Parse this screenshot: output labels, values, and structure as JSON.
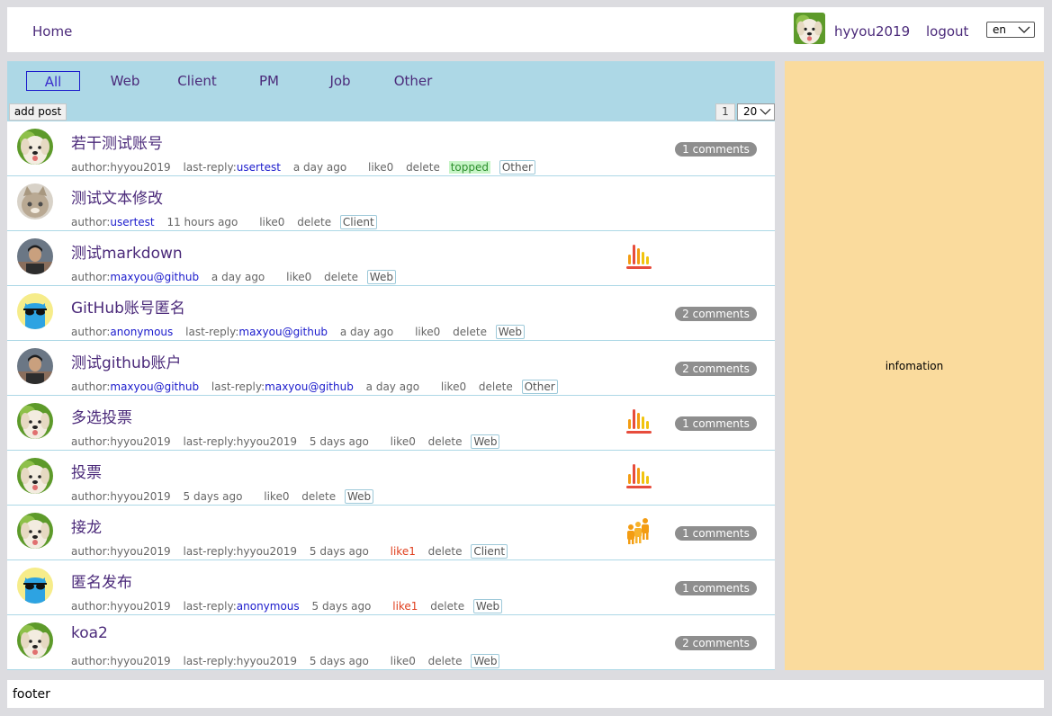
{
  "nav": {
    "home": "Home",
    "username": "hyyou2019",
    "logout": "logout",
    "lang": "en"
  },
  "tabs": [
    "All",
    "Web",
    "Client",
    "PM",
    "Job",
    "Other"
  ],
  "toolbar": {
    "add_post": "add post",
    "page": "1",
    "page_size": "20"
  },
  "info": "infomation",
  "footer": "footer",
  "posts": [
    {
      "title": "若干测试账号",
      "author_label": "author:",
      "author": "hyyou2019",
      "reply_label": "last-reply:",
      "reply": "usertest",
      "time": "a day ago",
      "like": "like0",
      "del": "delete",
      "topped": "topped",
      "tag": "Other",
      "comments": "1 comments"
    },
    {
      "title": "测试文本修改",
      "author_label": "author:",
      "author": "usertest",
      "time": "11 hours ago",
      "like": "like0",
      "del": "delete",
      "tag": "Client"
    },
    {
      "title": "测试markdown",
      "author_label": "author:",
      "author": "maxyou@github",
      "time": "a day ago",
      "like": "like0",
      "del": "delete",
      "tag": "Web"
    },
    {
      "title": "GitHub账号匿名",
      "author_label": "author:",
      "author": "anonymous",
      "reply_label": "last-reply:",
      "reply": "maxyou@github",
      "time": "a day ago",
      "like": "like0",
      "del": "delete",
      "tag": "Web",
      "comments": "2 comments"
    },
    {
      "title": "测试github账户",
      "author_label": "author:",
      "author": "maxyou@github",
      "reply_label": "last-reply:",
      "reply": "maxyou@github",
      "time": "a day ago",
      "like": "like0",
      "del": "delete",
      "tag": "Other",
      "comments": "2 comments"
    },
    {
      "title": "多选投票",
      "author_label": "author:",
      "author": "hyyou2019",
      "reply_label": "last-reply:",
      "reply": "hyyou2019",
      "time": "5 days ago",
      "like": "like0",
      "del": "delete",
      "tag": "Web",
      "comments": "1 comments"
    },
    {
      "title": "投票",
      "author_label": "author:",
      "author": "hyyou2019",
      "time": "5 days ago",
      "like": "like0",
      "del": "delete",
      "tag": "Web"
    },
    {
      "title": "接龙",
      "author_label": "author:",
      "author": "hyyou2019",
      "reply_label": "last-reply:",
      "reply": "hyyou2019",
      "time": "5 days ago",
      "like": "like1",
      "del": "delete",
      "tag": "Client",
      "comments": "1 comments"
    },
    {
      "title": "匿名发布",
      "author_label": "author:",
      "author": "hyyou2019",
      "reply_label": "last-reply:",
      "reply": "anonymous",
      "time": "5 days ago",
      "like": "like1",
      "del": "delete",
      "tag": "Web",
      "comments": "1 comments"
    },
    {
      "title": "koa2",
      "author_label": "author:",
      "author": "hyyou2019",
      "reply_label": "last-reply:",
      "reply": "hyyou2019",
      "time": "5 days ago",
      "like": "like0",
      "del": "delete",
      "tag": "Web",
      "comments": "2 comments"
    }
  ],
  "icons": {
    "vote": "bar-chart-icon",
    "relay": "people-group-icon"
  }
}
